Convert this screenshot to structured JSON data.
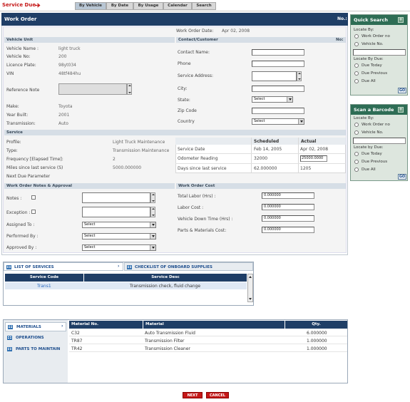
{
  "header": {
    "title": "Service Due",
    "arrow_icon": "arrow-right-icon"
  },
  "tabs": [
    {
      "label": "By Vehicle",
      "active": true
    },
    {
      "label": "By Date"
    },
    {
      "label": "By Usage"
    },
    {
      "label": "Calendar"
    },
    {
      "label": "Search"
    }
  ],
  "work_order": {
    "title": "Work Order",
    "no_label": "No.:",
    "date_label": "Work Order Date:",
    "date_value": "Apr 02, 2008"
  },
  "vehicle_unit": {
    "section": "Vehicle Unit",
    "fields": [
      {
        "label": "Vehicle Name :",
        "value": "light truck"
      },
      {
        "label": "Vehicle No:",
        "value": "200"
      },
      {
        "label": "Licence Plate:",
        "value": "98yt034"
      },
      {
        "label": "VIN",
        "value": "48tf484hu"
      }
    ],
    "reference_note_label": "Reference Note",
    "fields2": [
      {
        "label": "Make:",
        "value": "Toyota"
      },
      {
        "label": "Year Built:",
        "value": "2001"
      },
      {
        "label": "Transmission:",
        "value": "Auto"
      }
    ]
  },
  "contact": {
    "section": "Contact/Customer",
    "no_label": "No:",
    "labels": {
      "contact_name": "Contact Name:",
      "phone": "Phone",
      "service_address": "Service Address:",
      "city": "City:",
      "state": "State:",
      "zip": "Zip Code",
      "country": "Country"
    },
    "state_value": "Select",
    "country_value": "Select"
  },
  "service": {
    "section": "Service",
    "profile_label": "Profile:",
    "profile_value": "Light Truck Maintenance",
    "type_label": "Type:",
    "type_value": "Transmission Maintenance",
    "freq_label": "Frequency [Elapsed Time]:",
    "freq_value": "2",
    "miles_label": "Miles since last service (S)",
    "miles_value": "5000.000000",
    "next_label": "Next Due Parameter",
    "scheduled_header": "Scheduled",
    "actual_header": "Actual",
    "rows": [
      {
        "label": "Service Date",
        "scheduled": "Feb 14, 2005",
        "actual": "Apr 02, 2008"
      },
      {
        "label": "Odometer Reading",
        "scheduled": "32000",
        "actual": "25000.0000"
      },
      {
        "label": "Days since last service",
        "scheduled": "62.000000",
        "actual": "1205"
      }
    ]
  },
  "notes": {
    "section": "Work Order Notes & Approval",
    "notes_label": "Notes :",
    "exception_label": "Exception :",
    "assigned_label": "Assigned To :",
    "performed_label": "Performed By :",
    "approved_label": "Approved By :",
    "select": "Select"
  },
  "cost": {
    "section": "Work Order Cost",
    "labor_hrs_label": "Total Labor (Hrs) :",
    "labor_hrs_value": "0.000000",
    "labor_cost_label": "Labor Cost :",
    "labor_cost_value": "0.000000",
    "downtime_label": "Vehicle Down Time (Hrs) :",
    "downtime_value": "0.000000",
    "parts_label": "Parts & Materials Cost:",
    "parts_value": "0.000000"
  },
  "quick_search": {
    "title": "Quick Search",
    "locate_by": "Locate By:",
    "opt1": "Work Order no",
    "opt2": "Vehicle No.",
    "locate_due": "Locate By Due:",
    "due1": "Due Today",
    "due2": "Due Previous",
    "due3": "Due All",
    "go": "GO"
  },
  "scan": {
    "title": "Scan a Barcode",
    "locate_by": "Locate By:",
    "opt1": "Work Order no",
    "opt2": "Vehicle No.",
    "locate_due": "Locate by Due:",
    "due1": "Due Today",
    "due2": "Due Previous",
    "due3": "Due All",
    "go": "GO"
  },
  "services_panel": {
    "tab1": "LIST OF SERVICES",
    "tab2": "CHECKLIST OF ONBOARD SUPPLIES",
    "col1": "Service Code",
    "col2": "Service Desc",
    "rows": [
      {
        "code": "Trans1",
        "desc": "Transmission check, fluid change"
      }
    ]
  },
  "materials_panel": {
    "nav": [
      "MATERIALS",
      "OPERATIONS",
      "PARTS TO MAINTAIN"
    ],
    "col1": "Material No.",
    "col2": "Material",
    "col3": "Qty.",
    "rows": [
      {
        "no": "C32",
        "material": "Auto Transmission Fluid",
        "qty": "6.000000"
      },
      {
        "no": "TR87",
        "material": "Transmission Filter",
        "qty": "1.000000"
      },
      {
        "no": "TR42",
        "material": "Transmission Cleaner",
        "qty": "1.000000"
      }
    ]
  },
  "buttons": {
    "next": "NEXT",
    "cancel": "CANCEL"
  },
  "colors": {
    "accent_red": "#c51818",
    "header_navy": "#1f3e66",
    "panel_green": "#2e6d55"
  }
}
